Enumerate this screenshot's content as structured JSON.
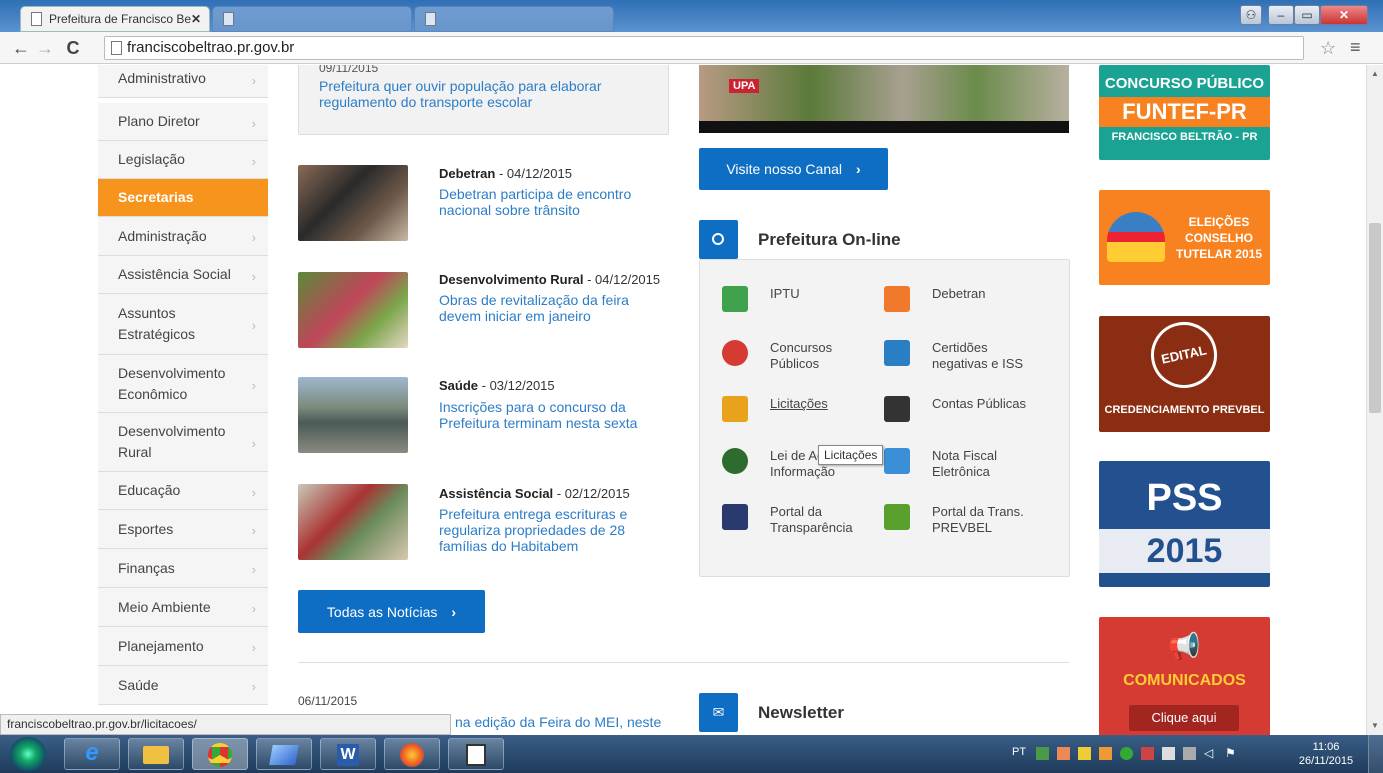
{
  "browser": {
    "active_tab": "Prefeitura de Francisco Be",
    "inactive_tabs": [
      "",
      ""
    ],
    "url": "franciscobeltrao.pr.gov.br",
    "status_url": "franciscobeltrao.pr.gov.br/licitacoes/"
  },
  "sidebar": {
    "items": [
      {
        "label": "Administrativo",
        "active": false
      },
      {
        "label": "Plano Diretor",
        "active": false
      },
      {
        "label": "Legislação",
        "active": false
      },
      {
        "label": "Secretarias",
        "active": true
      },
      {
        "label": "Administração",
        "active": false
      },
      {
        "label": "Assistência Social",
        "active": false
      },
      {
        "label": "Assuntos Estratégicos",
        "active": false
      },
      {
        "label": "Desenvolvimento Econômico",
        "active": false
      },
      {
        "label": "Desenvolvimento Rural",
        "active": false
      },
      {
        "label": "Educação",
        "active": false
      },
      {
        "label": "Esportes",
        "active": false
      },
      {
        "label": "Finanças",
        "active": false
      },
      {
        "label": "Meio Ambiente",
        "active": false
      },
      {
        "label": "Planejamento",
        "active": false
      },
      {
        "label": "Saúde",
        "active": false
      }
    ]
  },
  "featured": {
    "date": "09/11/2015",
    "title": "Prefeitura quer ouvir população para elaborar regulamento do transporte escolar"
  },
  "news": [
    {
      "category": "Debetran",
      "date": " - 04/12/2015",
      "title": "Debetran participa de encontro nacional sobre trânsito"
    },
    {
      "category": "Desenvolvimento Rural",
      "date": " - 04/12/2015",
      "title": "Obras de revitalização da feira devem iniciar em janeiro"
    },
    {
      "category": "Saúde",
      "date": " - 03/12/2015",
      "title": "Inscrições para o concurso da Prefeitura terminam nesta sexta"
    },
    {
      "category": "Assistência Social",
      "date": " - 02/12/2015",
      "title": "Prefeitura entrega escrituras e regulariza propriedades de 28 famílias do Habitabem"
    }
  ],
  "all_news_button": "Todas as Notícias",
  "bottom_news": {
    "date": "06/11/2015",
    "title": "na edição da Feira do MEI, neste"
  },
  "video": {
    "button": "Visite nosso Canal",
    "upa_label": "UPA"
  },
  "online": {
    "title": "Prefeitura On-line",
    "services": [
      {
        "label": "IPTU",
        "icon": "house-icon",
        "color": "#3fa34d"
      },
      {
        "label": "Debetran",
        "icon": "car-icon",
        "color": "#f0792b"
      },
      {
        "label": "Concursos Públicos",
        "icon": "person-icon",
        "color": "#d63b33"
      },
      {
        "label": "Certidões negativas e ISS",
        "icon": "document-icon",
        "color": "#2a7fc4"
      },
      {
        "label": "Licitações",
        "icon": "list-icon",
        "color": "#e8a21b"
      },
      {
        "label": "Contas Públicas",
        "icon": "calculator-icon",
        "color": "#333333"
      },
      {
        "label": "Lei de Acesso à Informação",
        "icon": "info-icon",
        "color": "#2d6b2f"
      },
      {
        "label": "Nota Fiscal Eletrônica",
        "icon": "invoice-icon",
        "color": "#3a8fd6"
      },
      {
        "label": "Portal da Transparência",
        "icon": "magnifier-icon",
        "color": "#2a3a6e"
      },
      {
        "label": "Portal da Trans. PREVBEL",
        "icon": "magnifier-leaf-icon",
        "color": "#5aa02c"
      }
    ],
    "tooltip": "Licitações"
  },
  "newsletter": {
    "title": "Newsletter"
  },
  "banners": [
    {
      "lines": [
        "CONCURSO PÚBLICO",
        "FUNTEF-PR",
        "FRANCISCO BELTRÃO - PR"
      ],
      "color": "#1aa293"
    },
    {
      "lines": [
        "ELEIÇÕES",
        "CONSELHO",
        "TUTELAR 2015"
      ],
      "color": "#f7821f"
    },
    {
      "lines": [
        "EDITAL",
        "CREDENCIAMENTO PREVBEL"
      ],
      "color": "#8b2d12"
    },
    {
      "lines": [
        "PSS",
        "2015"
      ],
      "color": "#23508e"
    },
    {
      "lines": [
        "COMUNICADOS",
        "Clique aqui"
      ],
      "color": "#d63b33"
    }
  ],
  "taskbar": {
    "lang": "PT",
    "time": "11:06",
    "date": "26/11/2015"
  }
}
